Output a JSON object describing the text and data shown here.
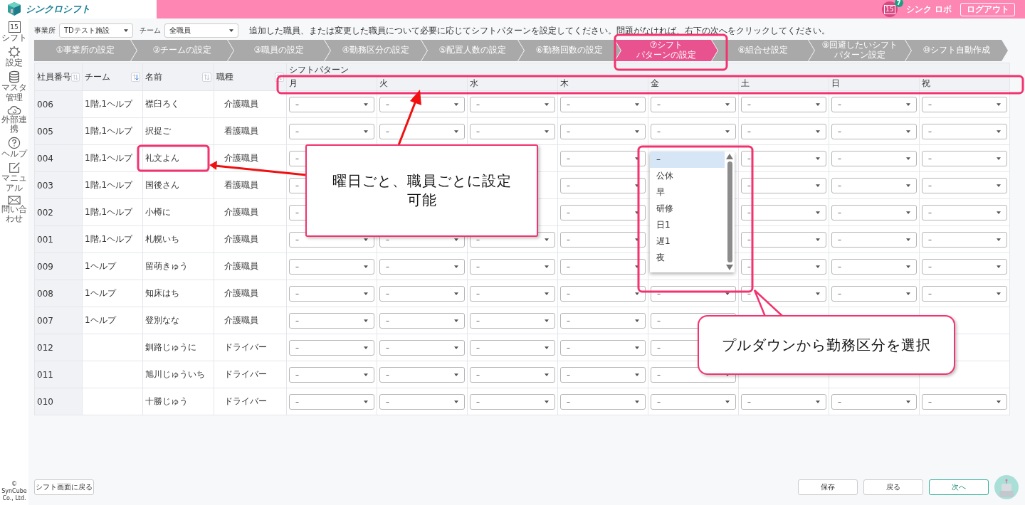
{
  "header": {
    "app_name": "シンクロシフト",
    "calendar_day": "15",
    "notification_count": "7",
    "user_name": "シンク ロボ",
    "logout_label": "ログアウト"
  },
  "sidebar": {
    "items": [
      {
        "label": "シフト",
        "day": "15"
      },
      {
        "label": "設定"
      },
      {
        "label": "マスタ管理"
      },
      {
        "label": "外部連携"
      },
      {
        "label": "ヘルプ"
      },
      {
        "label": "マニュアル"
      },
      {
        "label": "問い合わせ"
      }
    ],
    "copyright": "© SynCube Co., Ltd."
  },
  "filters": [
    {
      "label": "事業所",
      "value": "TDテスト施設"
    },
    {
      "label": "チーム",
      "value": "全職員"
    }
  ],
  "instruction": "追加した職員、または変更した職員について必要に応じてシフトパターンを設定してください。問題がなければ、右下の次へをクリックしてください。",
  "steps": [
    {
      "lines": [
        "①事業所の設定"
      ],
      "selected": false
    },
    {
      "lines": [
        "②チームの設定"
      ],
      "selected": false
    },
    {
      "lines": [
        "③職員の設定"
      ],
      "selected": false
    },
    {
      "lines": [
        "④勤務区分の設定"
      ],
      "selected": false
    },
    {
      "lines": [
        "⑤配置人数の設定"
      ],
      "selected": false
    },
    {
      "lines": [
        "⑥勤務回数の設定"
      ],
      "selected": false
    },
    {
      "lines": [
        "⑦シフト",
        "パターンの設定"
      ],
      "selected": true
    },
    {
      "lines": [
        "⑧組合せ設定"
      ],
      "selected": false
    },
    {
      "lines": [
        "⑨回避したいシフト",
        "パターン設定"
      ],
      "selected": false
    },
    {
      "lines": [
        "⑩シフト自動作成"
      ],
      "selected": false
    }
  ],
  "table": {
    "columns": [
      {
        "label": "社員番号",
        "sorted": false
      },
      {
        "label": "チーム",
        "sorted": true
      },
      {
        "label": "名前",
        "sorted": false
      },
      {
        "label": "職種",
        "sorted": false
      }
    ],
    "group_label": "シフトパターン",
    "days": [
      "月",
      "火",
      "水",
      "木",
      "金",
      "土",
      "日",
      "祝"
    ],
    "rows": [
      {
        "id": "006",
        "team": "1階,1ヘルプ",
        "name": "襟臼ろく",
        "role": "介護職員",
        "shifts": {
          "mon": "–",
          "tue": "–",
          "wed": "–",
          "thu": "–",
          "fri": "–",
          "sat": "–",
          "sun": "–",
          "hol": "–"
        }
      },
      {
        "id": "005",
        "team": "1階,1ヘルプ",
        "name": "択捉ご",
        "role": "看護職員",
        "shifts": {
          "mon": "–",
          "tue": "–",
          "wed": "–",
          "thu": "–",
          "fri": "–",
          "sat": "–",
          "sun": "–",
          "hol": "–"
        }
      },
      {
        "id": "004",
        "team": "1階,1ヘルプ",
        "name": "礼文よん",
        "role": "介護職員",
        "shifts": {
          "mon": "–",
          "thu": "–",
          "sat": "–",
          "sun": "–",
          "hol": "–"
        }
      },
      {
        "id": "003",
        "team": "1階,1ヘルプ",
        "name": "国後さん",
        "role": "看護職員",
        "shifts": {
          "mon": "–",
          "thu": "–",
          "sat": "–",
          "sun": "–",
          "hol": "–"
        }
      },
      {
        "id": "002",
        "team": "1階,1ヘルプ",
        "name": "小樽に",
        "role": "介護職員",
        "shifts": {
          "mon": "–",
          "thu": "–",
          "sat": "–",
          "sun": "–",
          "hol": "–"
        }
      },
      {
        "id": "001",
        "team": "1階,1ヘルプ",
        "name": "札幌いち",
        "role": "介護職員",
        "shifts": {
          "mon": "–",
          "tue": "–",
          "wed": "–",
          "thu": "–",
          "sat": "–",
          "sun": "–",
          "hol": "–"
        }
      },
      {
        "id": "009",
        "team": "1ヘルプ",
        "name": "留萌きゅう",
        "role": "介護職員",
        "shifts": {
          "mon": "–",
          "tue": "–",
          "wed": "–",
          "thu": "–",
          "sat": "–",
          "sun": "–",
          "hol": "–"
        }
      },
      {
        "id": "008",
        "team": "1ヘルプ",
        "name": "知床はち",
        "role": "介護職員",
        "shifts": {
          "mon": "–",
          "tue": "–",
          "wed": "–",
          "thu": "–",
          "fri": "–",
          "sat": "–",
          "sun": "–",
          "hol": "–"
        }
      },
      {
        "id": "007",
        "team": "1ヘルプ",
        "name": "登別なな",
        "role": "介護職員",
        "shifts": {
          "mon": "–",
          "tue": "–",
          "wed": "–",
          "thu": "–",
          "fri": "–"
        }
      },
      {
        "id": "012",
        "name": "釧路じゅうに",
        "role": "ドライバー",
        "shifts": {
          "mon": "–",
          "tue": "–",
          "wed": "–",
          "thu": "–",
          "fri": "–"
        }
      },
      {
        "id": "011",
        "name": "旭川じゅういち",
        "role": "ドライバー",
        "shifts": {
          "mon": "–",
          "tue": "–",
          "wed": "–",
          "thu": "–",
          "fri": "–"
        }
      },
      {
        "id": "010",
        "name": "十勝じゅう",
        "role": "ドライバー",
        "shifts": {
          "mon": "–",
          "tue": "–",
          "wed": "–",
          "thu": "–",
          "fri": "–",
          "sat": "–",
          "sun": "–",
          "hol": "–"
        }
      }
    ]
  },
  "dropdown_list": {
    "options": [
      {
        "label": "–",
        "selected": true
      },
      {
        "label": "公休",
        "selected": false
      },
      {
        "label": "早",
        "selected": false
      },
      {
        "label": "研修",
        "selected": false
      },
      {
        "label": "日1",
        "selected": false
      },
      {
        "label": "遅1",
        "selected": false
      },
      {
        "label": "夜",
        "selected": false
      }
    ]
  },
  "footer": {
    "back_to_shift": "シフト画面に戻る",
    "buttons": [
      {
        "label": "保存",
        "kind": "plain"
      },
      {
        "label": "戻る",
        "kind": "plain"
      },
      {
        "label": "次へ",
        "kind": "primary"
      }
    ]
  },
  "annotations": [
    {
      "text": "曜日ごと、職員ごとに設定可能"
    },
    {
      "text": "プルダウンから勤務区分を選択"
    }
  ]
}
